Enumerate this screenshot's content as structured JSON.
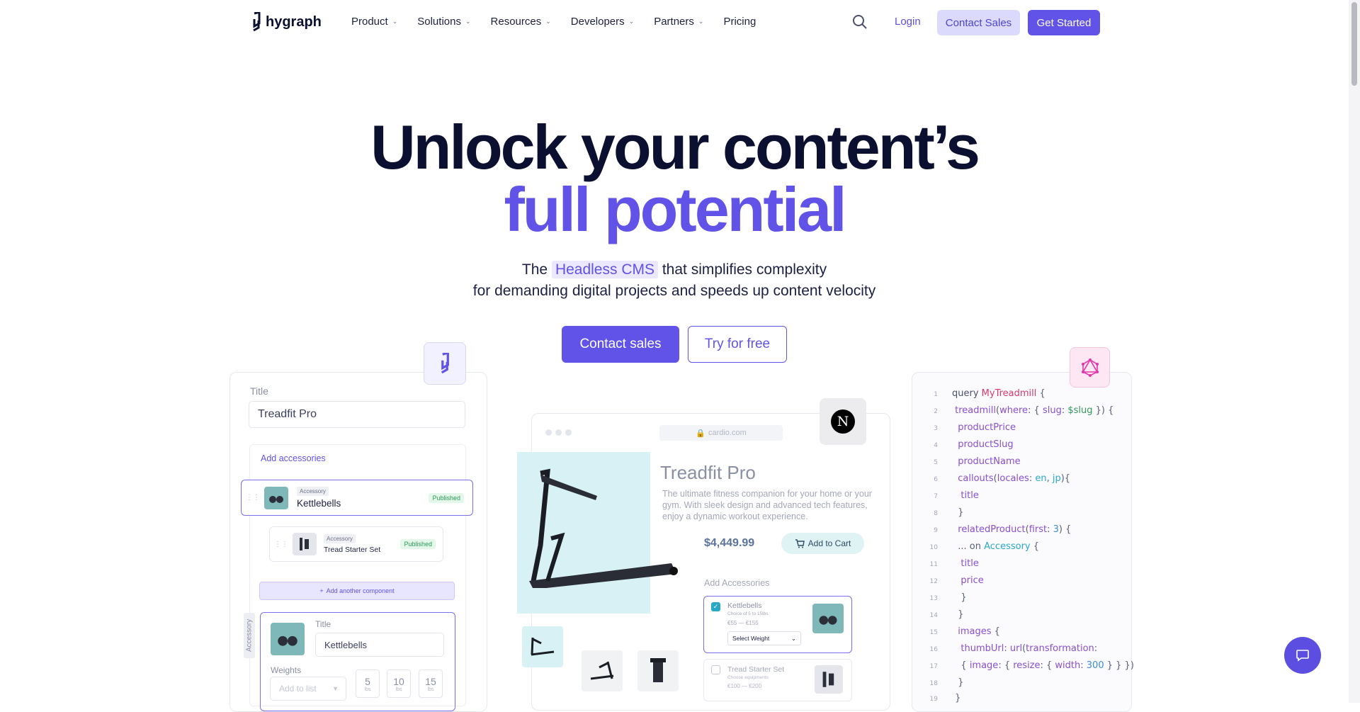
{
  "nav": {
    "logo_text": "hygraph",
    "items": [
      {
        "label": "Product",
        "dropdown": true
      },
      {
        "label": "Solutions",
        "dropdown": true
      },
      {
        "label": "Resources",
        "dropdown": true
      },
      {
        "label": "Developers",
        "dropdown": true
      },
      {
        "label": "Partners",
        "dropdown": true
      },
      {
        "label": "Pricing",
        "dropdown": false
      }
    ],
    "login": "Login",
    "contact_sales": "Contact Sales",
    "get_started": "Get Started"
  },
  "hero": {
    "title_line1": "Unlock your content’s",
    "title_line2": "full potential",
    "sub_pre": "The",
    "sub_highlight": "Headless CMS",
    "sub_post": "that simplifies complexity",
    "sub_line2": "for demanding digital projects and speeds up content velocity",
    "cta_primary": "Contact sales",
    "cta_secondary": "Try for free"
  },
  "editor": {
    "title_label": "Title",
    "title_value": "Treadfit Pro",
    "add_accessories": "Add accessories",
    "items": [
      {
        "tag": "Accessory",
        "name": "Kettlebells",
        "status": "Published"
      },
      {
        "tag": "Accessory",
        "name": "Tread Starter Set",
        "status": "Published"
      }
    ],
    "add_component": "Add another component",
    "side_label": "Accessory",
    "nested_title_label": "Title",
    "nested_title_value": "Kettlebells",
    "weights_label": "Weights",
    "add_to_list": "Add to list",
    "weights": [
      {
        "value": "5",
        "unit": "lbs"
      },
      {
        "value": "10",
        "unit": "lbs"
      },
      {
        "value": "15",
        "unit": "lbs"
      }
    ]
  },
  "preview": {
    "url": "cardio.com",
    "product_title": "Treadfit Pro",
    "description": "The ultimate fitness companion for your home or your gym. With sleek design and advanced tech features, enjoy a dynamic workout experience.",
    "price": "$4,449.99",
    "add_to_cart": "Add to Cart",
    "add_accessories": "Add Accessories",
    "options": [
      {
        "name": "Kettlebells",
        "detail": "Choice of 5 to 15lbs",
        "price": "€55 — €155",
        "checked": true,
        "select": "Select Weight"
      },
      {
        "name": "Tread Starter Set",
        "detail": "Choose equipments",
        "price": "€100 — €200",
        "checked": false
      }
    ],
    "next_letter": "N"
  },
  "code": {
    "lines": [
      "1",
      "2",
      "3",
      "4",
      "5",
      "6",
      "7",
      "8",
      "9",
      "10",
      "11",
      "12",
      "13",
      "14",
      "15",
      "16",
      "17",
      "18",
      "19"
    ]
  },
  "colors": {
    "brand": "#6153e8",
    "dark": "#0b1030"
  }
}
